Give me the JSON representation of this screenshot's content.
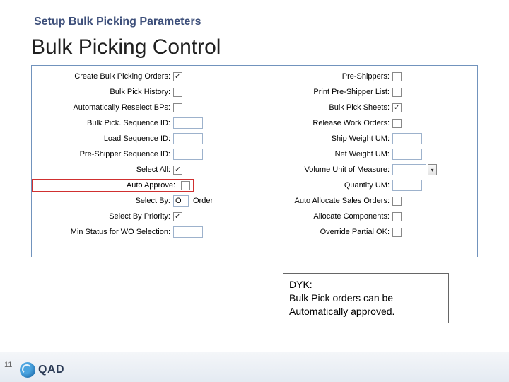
{
  "subtitle": "Setup Bulk Picking Parameters",
  "title": "Bulk Picking Control",
  "left_rows": [
    {
      "label": "Create Bulk Picking Orders:",
      "type": "checkbox",
      "checked": true,
      "highlight": false
    },
    {
      "label": "Bulk Pick History:",
      "type": "checkbox",
      "checked": false,
      "highlight": false
    },
    {
      "label": "Automatically Reselect BPs:",
      "type": "checkbox",
      "checked": false,
      "highlight": false
    },
    {
      "label": "Bulk Pick. Sequence ID:",
      "type": "text",
      "value": "",
      "width": "med"
    },
    {
      "label": "Load Sequence ID:",
      "type": "text",
      "value": "",
      "width": "med"
    },
    {
      "label": "Pre-Shipper Sequence ID:",
      "type": "text",
      "value": "",
      "width": "med"
    },
    {
      "label": "Select All:",
      "type": "checkbox",
      "checked": true,
      "highlight": false
    },
    {
      "label": "Auto Approve:",
      "type": "checkbox",
      "checked": false,
      "highlight": true
    },
    {
      "label": "Select By:",
      "type": "text",
      "value": "O",
      "width": "short",
      "extra": "Order"
    },
    {
      "label": "Select By Priority:",
      "type": "checkbox",
      "checked": true,
      "highlight": false
    },
    {
      "label": "Min Status for WO Selection:",
      "type": "text",
      "value": "",
      "width": "med"
    }
  ],
  "right_rows": [
    {
      "label": "Pre-Shippers:",
      "type": "checkbox",
      "checked": false
    },
    {
      "label": "Print Pre-Shipper List:",
      "type": "checkbox",
      "checked": false
    },
    {
      "label": "Bulk Pick Sheets:",
      "type": "checkbox",
      "checked": true
    },
    {
      "label": "Release Work Orders:",
      "type": "checkbox",
      "checked": false
    },
    {
      "label": "Ship Weight UM:",
      "type": "text",
      "value": "",
      "width": "med"
    },
    {
      "label": "Net Weight UM:",
      "type": "text",
      "value": "",
      "width": "med"
    },
    {
      "label": "Volume Unit of Measure:",
      "type": "text",
      "value": "",
      "width": "wide",
      "dropdown": true
    },
    {
      "label": "Quantity UM:",
      "type": "text",
      "value": "",
      "width": "med"
    },
    {
      "label": "Auto Allocate Sales Orders:",
      "type": "checkbox",
      "checked": false
    },
    {
      "label": "Allocate Components:",
      "type": "checkbox",
      "checked": false
    },
    {
      "label": "Override Partial OK:",
      "type": "checkbox",
      "checked": false
    }
  ],
  "dyk": {
    "heading": "DYK:",
    "line1": "Bulk Pick orders can be",
    "line2": "Automatically approved."
  },
  "page_number": "11",
  "logo_text": "QAD"
}
